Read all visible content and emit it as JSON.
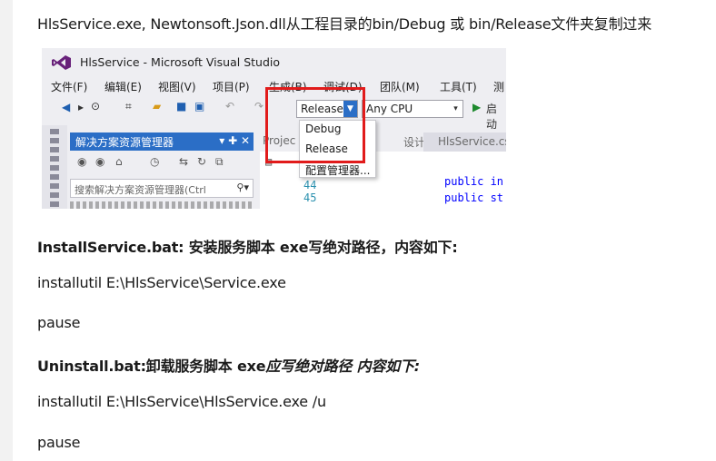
{
  "header_line": "HlsService.exe, Newtonsoft.Json.dll从工程目录的bin/Debug 或 bin/Release文件夹复制过来",
  "vs": {
    "title": "HlsService - Microsoft Visual Studio",
    "menu": [
      "文件(F)",
      "编辑(E)",
      "视图(V)",
      "项目(P)",
      "生成(B)",
      "调试(D)",
      "团队(M)",
      "工具(T)",
      "测"
    ],
    "config_selected": "Release",
    "platform_selected": "Any CPU",
    "start_label": "启动",
    "config_options": [
      "Debug",
      "Release",
      "配置管理器..."
    ],
    "solution_explorer_title": "解决方案资源管理器",
    "solution_explorer_controls": "▾ ✚ ✕",
    "search_placeholder": "搜索解决方案资源管理器(Ctrl",
    "tabs": [
      "Projec",
      "设计]",
      "HlsService.cs"
    ],
    "code_lines": [
      {
        "num": "44",
        "text": "public in"
      },
      {
        "num": "45",
        "text": "public st"
      }
    ],
    "accent_color": "#2b6ec6",
    "highlight_color": "#e11b1b"
  },
  "sections": {
    "install_heading": "InstallService.bat:   安装服务脚本  exe写绝对路径，内容如下:",
    "install_cmd": "installutil E:\\HlsService\\Service.exe",
    "install_pause": "pause",
    "uninstall_heading_a": "Uninstall.bat:卸载服务脚本 exe",
    "uninstall_heading_b": "应写绝对路径 内容如下:",
    "uninstall_cmd": "installutil E:\\HlsService\\HlsService.exe /u",
    "uninstall_pause": "pause"
  }
}
